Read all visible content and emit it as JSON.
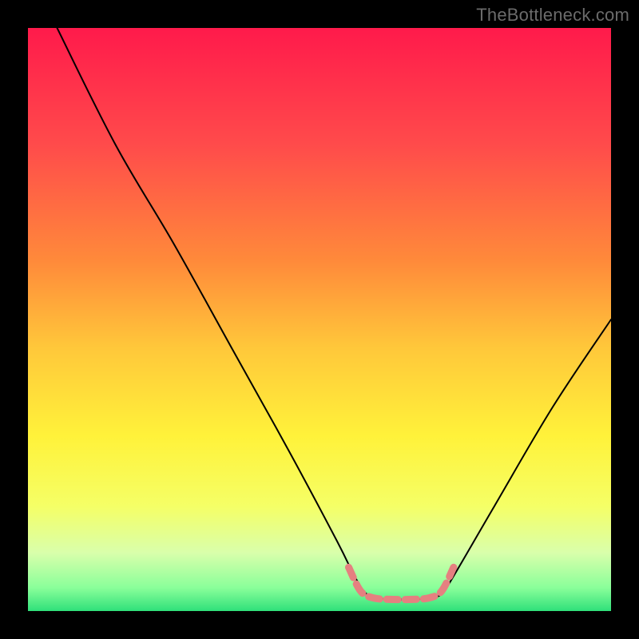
{
  "watermark": "TheBottleneck.com",
  "chart_data": {
    "type": "line",
    "title": "",
    "xlabel": "",
    "ylabel": "",
    "xlim": [
      0,
      100
    ],
    "ylim": [
      0,
      100
    ],
    "gradient_stops": [
      {
        "offset": 0,
        "color": "#ff1a4b"
      },
      {
        "offset": 20,
        "color": "#ff4b4b"
      },
      {
        "offset": 40,
        "color": "#ff8a3a"
      },
      {
        "offset": 55,
        "color": "#ffc83a"
      },
      {
        "offset": 70,
        "color": "#fff23a"
      },
      {
        "offset": 82,
        "color": "#f5ff66"
      },
      {
        "offset": 90,
        "color": "#d9ffab"
      },
      {
        "offset": 96,
        "color": "#8aff9a"
      },
      {
        "offset": 100,
        "color": "#2fe07a"
      }
    ],
    "series": [
      {
        "name": "bottleneck-curve",
        "stroke": "#000000",
        "data": [
          {
            "x": 5,
            "y": 100
          },
          {
            "x": 15,
            "y": 80
          },
          {
            "x": 25,
            "y": 63
          },
          {
            "x": 35,
            "y": 45
          },
          {
            "x": 45,
            "y": 27
          },
          {
            "x": 53,
            "y": 12
          },
          {
            "x": 56,
            "y": 6
          },
          {
            "x": 58,
            "y": 3
          },
          {
            "x": 60,
            "y": 2.2
          },
          {
            "x": 63,
            "y": 2
          },
          {
            "x": 66,
            "y": 2
          },
          {
            "x": 69,
            "y": 2.2
          },
          {
            "x": 71,
            "y": 3
          },
          {
            "x": 73,
            "y": 6
          },
          {
            "x": 80,
            "y": 18
          },
          {
            "x": 90,
            "y": 35
          },
          {
            "x": 100,
            "y": 50
          }
        ]
      },
      {
        "name": "flat-bottom-highlight",
        "stroke": "#e58080",
        "data": [
          {
            "x": 55,
            "y": 7.5
          },
          {
            "x": 57,
            "y": 3.5
          },
          {
            "x": 59,
            "y": 2.3
          },
          {
            "x": 62,
            "y": 2.0
          },
          {
            "x": 66,
            "y": 2.0
          },
          {
            "x": 69,
            "y": 2.3
          },
          {
            "x": 71,
            "y": 3.5
          },
          {
            "x": 73,
            "y": 7.5
          }
        ]
      }
    ]
  }
}
